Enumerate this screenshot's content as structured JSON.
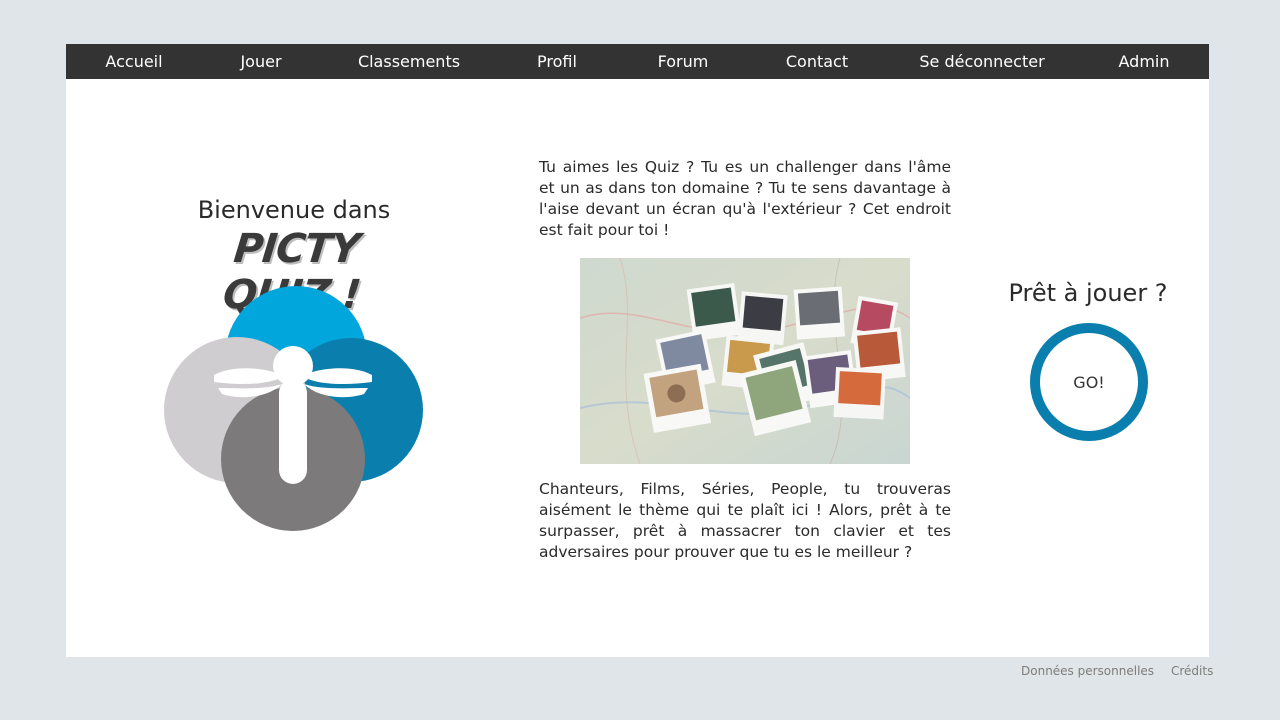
{
  "nav": {
    "items": [
      {
        "label": "Accueil"
      },
      {
        "label": "Jouer"
      },
      {
        "label": "Classements"
      },
      {
        "label": "Profil"
      },
      {
        "label": "Forum"
      },
      {
        "label": "Contact"
      },
      {
        "label": "Se déconnecter"
      },
      {
        "label": "Admin"
      }
    ]
  },
  "hero": {
    "welcome": "Bienvenue dans",
    "brand": "PICTY QUIZ !"
  },
  "content": {
    "intro": "Tu aimes les Quiz ? Tu es un challenger dans l'âme et un as dans ton domaine ? Tu te sens davantage à l'aise devant un écran qu'à l'extérieur ? Cet endroit est fait pour toi !",
    "outro": "Chanteurs, Films, Séries, People, tu trouveras aisément le thème qui te plaît ici ! Alors, prêt à te surpasser, prêt à massacrer ton clavier et tes adversaires pour prouver que tu es le meilleur ?"
  },
  "play": {
    "prompt": "Prêt à jouer ?",
    "button_label": "GO!"
  },
  "footer": {
    "privacy": "Données personnelles",
    "credits": "Crédits"
  },
  "colors": {
    "navbar": "#333333",
    "accent": "#0a7fae",
    "logo_blue_light": "#00a6dc",
    "logo_blue_dark": "#0a7fae",
    "logo_gray_light": "#cfcdcf",
    "logo_gray_dark": "#7d7a7b"
  }
}
